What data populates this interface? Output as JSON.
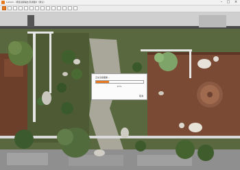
{
  "window": {
    "title": "Lumion – 项目渲染输出/高清图片（默认）",
    "minimize": "–",
    "maximize": "□",
    "close": "×"
  },
  "toolbar": {
    "buttons": [
      "new-icon",
      "open-icon",
      "save-icon",
      "undo-icon",
      "redo-icon",
      "cut-icon",
      "copy-icon",
      "paste-icon",
      "render-icon",
      "camera-icon",
      "settings-icon",
      "layers-icon",
      "export-icon",
      "help-icon"
    ]
  },
  "progress_dialog": {
    "label": "正在渲染图像…",
    "progress": 0.27,
    "percent_text": "27%",
    "cancel": "取消"
  },
  "colors": {
    "accent": "#e8791f"
  }
}
